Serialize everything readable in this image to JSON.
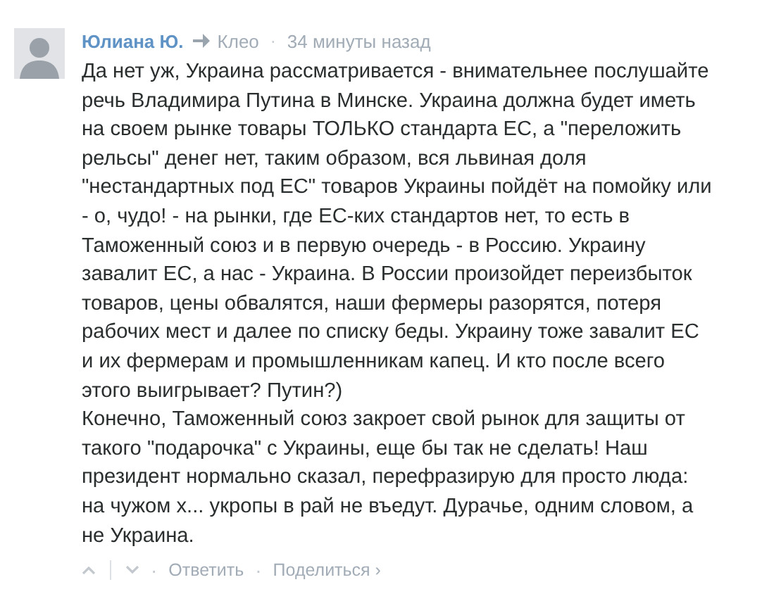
{
  "comment": {
    "author": "Юлиана Ю.",
    "reply_to": "Клео",
    "separator": "·",
    "time": "34 минуты назад",
    "paragraphs": [
      [
        "Да нет уж, Украина рассматривается - внимательнее послушайте",
        "речь Владимира Путина в Минске. Украина должна будет иметь",
        "на своем рынке товары ТОЛЬКО стандарта ЕС, а \"переложить",
        "рельсы\" денег нет, таким образом, вся львиная доля",
        "\"нестандартных под ЕС\" товаров Украины пойдёт на помойку или",
        "- о, чудо! - на рынки, где ЕС-ких стандартов нет, то есть в",
        "Таможенный союз и в первую очередь - в Россию. Украину",
        "завалит ЕС, а нас - Украина. В России произойдет переизбыток",
        "товаров, цены обвалятся, наши фермеры разорятся, потеря",
        "рабочих мест и далее по списку беды. Украину тоже завалит ЕС",
        "и их фермерам и промышленникам капец. И кто после всего",
        "этого выигрывает? Путин?)"
      ],
      [
        "Конечно, Таможенный союз закроет свой рынок для защиты от",
        "такого \"подарочка\" с Украины, еще бы так не сделать! Наш",
        "президент нормально сказал, перефразирую для просто люда:",
        "на чужом х... укропы в рай не въедут. Дурачье, одним словом, а",
        "не Украина."
      ]
    ],
    "actions": [
      {
        "label": "Ответить"
      },
      {
        "label": "Поделиться ›"
      }
    ]
  }
}
